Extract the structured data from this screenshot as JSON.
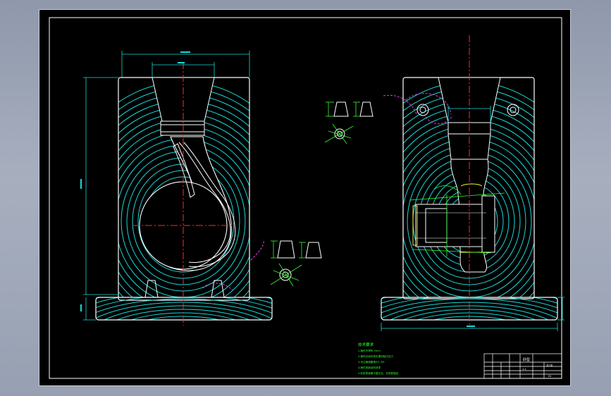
{
  "drawing": {
    "notes": {
      "heading": "技术要求",
      "lines": [
        "1.铸件不得有 5mm",
        "2.铸件应经时效处理消除内应力",
        "3.未注铸造圆角R3~R5",
        "4.铸件表面涂防锈漆",
        "5.砂型表面需平整光洁，无明显裂纹"
      ]
    },
    "title_block": {
      "name": "砂型",
      "scale": "1:1",
      "sheet": "共1张",
      "drawing_no": "01"
    },
    "colors": {
      "background": "#000000",
      "outline": "#ffffff",
      "grain": "#19d8d8",
      "center_line": "#ff2a2a",
      "hatch": "#e040e0",
      "dimension": "#19d8d8",
      "annotation": "#30ff30",
      "highlight": "#ffff33"
    }
  }
}
